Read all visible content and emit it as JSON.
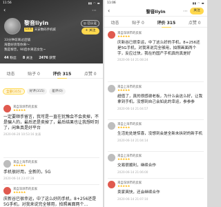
{
  "left": {
    "status": {
      "time": "11:56",
      "icons": "▮▮ ◠ ▬"
    },
    "profile": {
      "name": "黎音liyin",
      "tag": "Lv.4",
      "tag_desc": "天安数码手机城",
      "verified": "◎ 已认证",
      "follow": "+ 关注",
      "bio1": "33分钟前来过店铺",
      "bio2": "海量好货等你来～",
      "bio3": "我是黎音，90后水果店女生~",
      "stats": [
        {
          "num": "44",
          "label": "粉丝"
        },
        {
          "num": "8",
          "label": "关注"
        },
        {
          "num": "2476",
          "label": "获赞"
        }
      ]
    },
    "tabs": [
      "动态",
      "贴子 0",
      "评价 315",
      "点赞 0"
    ],
    "filters": [
      "全部(315)",
      "好评(315)",
      "差评(0)"
    ],
    "comments": [
      {
        "user": "来自深圳市的卖家",
        "stars": "★★★★★",
        "text": "一定要顺手留言，我可是一直在犹豫会不会卖掉，不是骗人的，最后还是卖掉了，最后结果也让我想听到了，闲鱼真是好平台",
        "time": "2020-06-20 10:53:16 发表"
      },
      {
        "user": "来自上海市的卖家",
        "stars": "★★★★★",
        "text": "手机很好用，全新的，5G",
        "time": "2020-06-14 23:47:28"
      },
      {
        "user": "来自深圳市的卖家",
        "stars": "★★★★★",
        "text": "庆新谷已很幸运，中了这么好的手机，8+256还是5G手机，对我来说完全够用，拍照画面两个…",
        "time": ""
      }
    ]
  },
  "right": {
    "status": {
      "time": "11:06",
      "icons": "▮▮ ◠ ▬"
    },
    "title": "黎音liyin",
    "follow": "关注",
    "tabs": [
      "动态",
      "贴子 0",
      "评价 315",
      "点赞 0"
    ],
    "comments": [
      {
        "user": "来自深圳市的卖家",
        "stars": "★★★★★",
        "text": "庆新谷已很幸运，中了这么好的手机，8+256还是5G手机，对我来说完全够用，拍照画面两个字，反应过快，我在的国产手机真的真是好",
        "time": "2020-06-14 21:08:24"
      },
      {
        "user": "来自上海市的卖家",
        "stars": "★★★★★",
        "text": "超值了，真的很感谢老板，为什么会这么好，让我拿到手机，没想到自己会如此的幸运，参参参",
        "time": "2020-06-14 21:04:57"
      },
      {
        "user": "来自上海市的卖家",
        "stars": "★★★★★",
        "text": "生活处处是惊喜，没想到会是全新未拆封的新手机",
        "time": "2020-06-14 21:04:14"
      },
      {
        "user": "来自上海市的卖家",
        "stars": "★★★★★",
        "text": "交易很顺利，继续合作",
        "time": "2020-06-14 21:06:00"
      },
      {
        "user": "来自深圳市的卖家",
        "stars": "★★★★★",
        "text": "卖家爽快，还会继续合作",
        "time": "2020-06-14 21:07:10"
      }
    ]
  }
}
